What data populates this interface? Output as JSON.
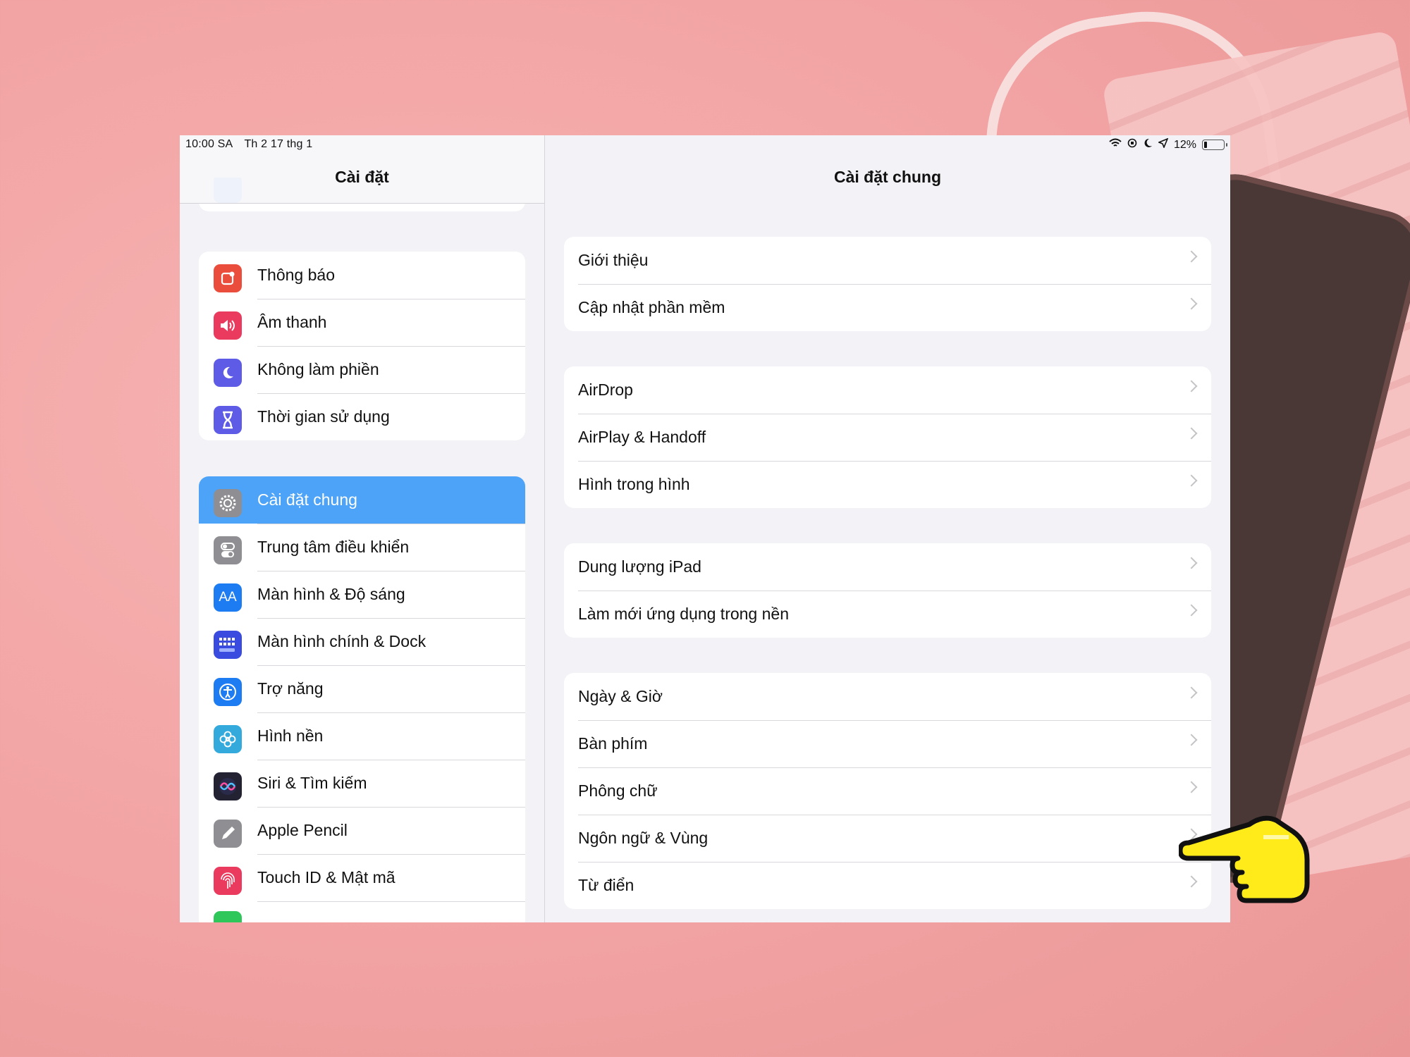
{
  "status": {
    "time": "10:00 SA",
    "date": "Th 2 17 thg 1",
    "battery": "12%"
  },
  "sidebar": {
    "title": "Cài đặt",
    "groups": [
      {
        "items": [
          {
            "label": "Thông báo",
            "icon": "notifications-icon",
            "color": "#eb4d3d"
          },
          {
            "label": "Âm thanh",
            "icon": "speaker-icon",
            "color": "#ea3a5e"
          },
          {
            "label": "Không làm phiền",
            "icon": "moon-icon",
            "color": "#5e5ce6"
          },
          {
            "label": "Thời gian sử dụng",
            "icon": "hourglass-icon",
            "color": "#5e5ce6"
          }
        ]
      },
      {
        "items": [
          {
            "label": "Cài đặt chung",
            "icon": "gear-icon",
            "color": "#8e8e93",
            "selected": true
          },
          {
            "label": "Trung tâm điều khiển",
            "icon": "toggles-icon",
            "color": "#8e8e93"
          },
          {
            "label": "Màn hình & Độ sáng",
            "icon": "text-size-icon",
            "color": "#1e7cf2"
          },
          {
            "label": "Màn hình chính & Dock",
            "icon": "app-grid-icon",
            "color": "#3a4be0"
          },
          {
            "label": "Trợ năng",
            "icon": "accessibility-icon",
            "color": "#1e7cf2"
          },
          {
            "label": "Hình nền",
            "icon": "flower-icon",
            "color": "#34aadc"
          },
          {
            "label": "Siri & Tìm kiếm",
            "icon": "siri-icon",
            "color": "#222233"
          },
          {
            "label": "Apple Pencil",
            "icon": "pencil-icon",
            "color": "#8e8e93"
          },
          {
            "label": "Touch ID & Mật mã",
            "icon": "fingerprint-icon",
            "color": "#ea3a5e"
          }
        ]
      }
    ]
  },
  "detail": {
    "title": "Cài đặt chung",
    "groups": [
      {
        "items": [
          {
            "label": "Giới thiệu"
          },
          {
            "label": "Cập nhật phần mềm"
          }
        ]
      },
      {
        "items": [
          {
            "label": "AirDrop"
          },
          {
            "label": "AirPlay & Handoff"
          },
          {
            "label": "Hình trong hình"
          }
        ]
      },
      {
        "items": [
          {
            "label": "Dung lượng iPad"
          },
          {
            "label": "Làm mới ứng dụng trong nền"
          }
        ]
      },
      {
        "items": [
          {
            "label": "Ngày & Giờ"
          },
          {
            "label": "Bàn phím"
          },
          {
            "label": "Phông chữ"
          },
          {
            "label": "Ngôn ngữ & Vùng"
          },
          {
            "label": "Từ điển"
          }
        ]
      }
    ]
  },
  "accent": "#4da3f7",
  "pointer_icon": "pointing-hand-icon"
}
